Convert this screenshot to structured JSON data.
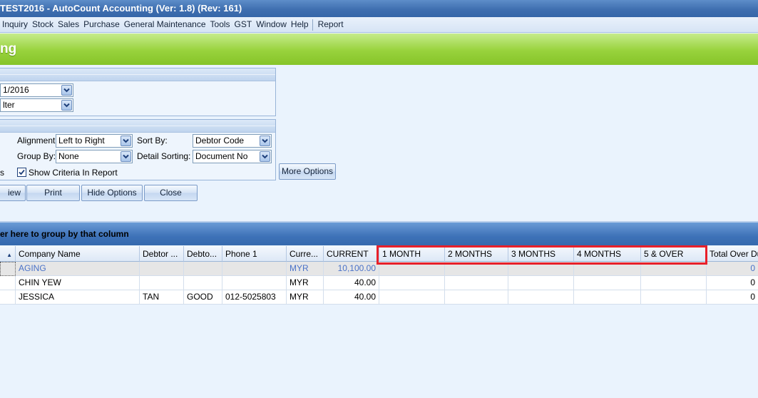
{
  "window": {
    "title": "TEST2016 - AutoCount Accounting (Ver: 1.8) (Rev: 161)"
  },
  "menu": {
    "items": [
      "Inquiry",
      "Stock",
      "Sales",
      "Purchase",
      "General Maintenance",
      "Tools",
      "GST",
      "Window",
      "Help",
      "Report"
    ]
  },
  "header": {
    "title": "ng"
  },
  "filter": {
    "date_value": "1/2016",
    "filter_value": "lter"
  },
  "options": {
    "alignment_label": "Alignment:",
    "alignment_value": "Left to Right",
    "sort_by_label": "Sort By:",
    "sort_by_value": "Debtor Code",
    "group_by_label": "Group By:",
    "group_by_value": "None",
    "detail_sorting_label": "Detail Sorting:",
    "detail_sorting_value": "Document No",
    "left_fragment": "s",
    "show_criteria_label": "Show Criteria In Report",
    "show_criteria_checked": true,
    "more_options_label": "More Options"
  },
  "buttons": {
    "preview": "iew",
    "print": "Print",
    "hide_options": "Hide Options",
    "close": "Close"
  },
  "grid": {
    "group_prompt": "er here to group by that column",
    "columns": [
      "",
      "Company Name",
      "Debtor ...",
      "Debto...",
      "Phone 1",
      "Curre...",
      "CURRENT",
      "1 MONTH",
      "2 MONTHS",
      "3 MONTHS",
      "4 MONTHS",
      "5 & OVER",
      "Total Over Du"
    ],
    "rows": [
      [
        "",
        "AGING",
        "",
        "",
        "",
        "MYR",
        "10,100.00",
        "",
        "",
        "",
        "",
        "",
        "0"
      ],
      [
        "",
        "CHIN YEW",
        "",
        "",
        "",
        "MYR",
        "40.00",
        "",
        "",
        "",
        "",
        "",
        "0"
      ],
      [
        "",
        "JESSICA",
        "TAN",
        "GOOD",
        "012-5025803",
        "MYR",
        "40.00",
        "",
        "",
        "",
        "",
        "",
        "0"
      ]
    ]
  },
  "colors": {
    "title_bar": "#3f6fb0",
    "header_green": "#98d23c",
    "highlight": "#e8202a",
    "aging_row_text": "#4a72c8"
  }
}
